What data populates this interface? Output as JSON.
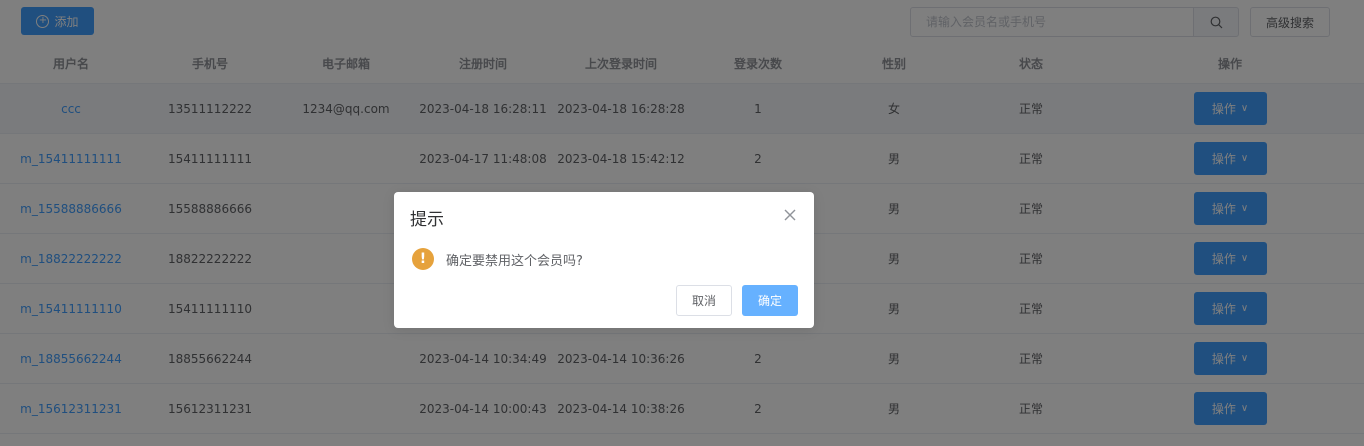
{
  "toolbar": {
    "add_label": "添加",
    "search_placeholder": "请输入会员名或手机号",
    "search_value": "",
    "advanced_label": "高级搜索"
  },
  "table": {
    "headers": [
      "用户名",
      "手机号",
      "电子邮箱",
      "注册时间",
      "上次登录时间",
      "登录次数",
      "性别",
      "状态",
      "操作"
    ],
    "rows": [
      {
        "username": "ccc",
        "phone": "13511112222",
        "email": "1234@qq.com",
        "registered": "2023-04-18 16:28:11",
        "last_login": "2023-04-18 16:28:28",
        "logins": "1",
        "gender": "女",
        "status": "正常"
      },
      {
        "username": "m_15411111111",
        "phone": "15411111111",
        "email": "",
        "registered": "2023-04-17 11:48:08",
        "last_login": "2023-04-18 15:42:12",
        "logins": "2",
        "gender": "男",
        "status": "正常"
      },
      {
        "username": "m_15588886666",
        "phone": "15588886666",
        "email": "",
        "registered": "",
        "last_login": "",
        "logins": "",
        "gender": "男",
        "status": "正常"
      },
      {
        "username": "m_18822222222",
        "phone": "18822222222",
        "email": "",
        "registered": "",
        "last_login": "",
        "logins": "",
        "gender": "男",
        "status": "正常"
      },
      {
        "username": "m_15411111110",
        "phone": "15411111110",
        "email": "",
        "registered": "",
        "last_login": "",
        "logins": "",
        "gender": "男",
        "status": "正常"
      },
      {
        "username": "m_18855662244",
        "phone": "18855662244",
        "email": "",
        "registered": "2023-04-14 10:34:49",
        "last_login": "2023-04-14 10:36:26",
        "logins": "2",
        "gender": "男",
        "status": "正常"
      },
      {
        "username": "m_15612311231",
        "phone": "15612311231",
        "email": "",
        "registered": "2023-04-14 10:00:43",
        "last_login": "2023-04-14 10:38:26",
        "logins": "2",
        "gender": "男",
        "status": "正常"
      }
    ],
    "action_label": "操作"
  },
  "dialog": {
    "title": "提示",
    "message": "确定要禁用这个会员吗?",
    "cancel_label": "取消",
    "confirm_label": "确定"
  },
  "colors": {
    "primary": "#409eff",
    "warning": "#e6a23c",
    "confirm_light": "#66b1ff"
  }
}
